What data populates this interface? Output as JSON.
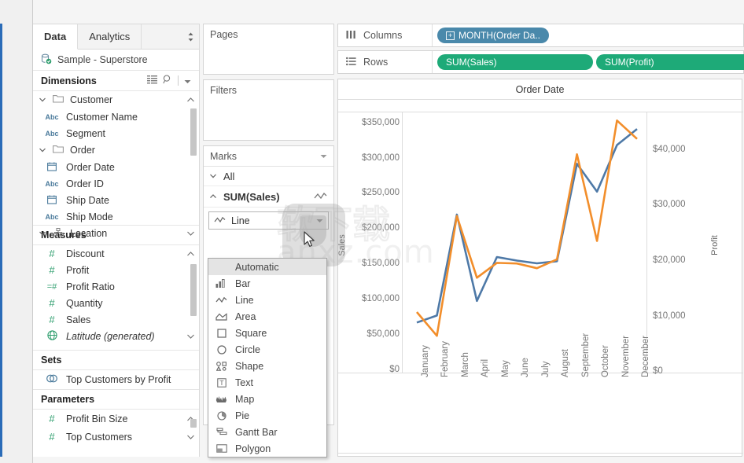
{
  "app": {
    "title": "Tableau Desktop Worksheet"
  },
  "sidebar": {
    "tabs": [
      {
        "label": "Data",
        "active": true
      },
      {
        "label": "Analytics",
        "active": false
      }
    ],
    "tab_caret_icon": "sort-caret-icon",
    "datasource": {
      "name": "Sample - Superstore",
      "icon": "database-connected-icon"
    },
    "dimensions": {
      "header": "Dimensions",
      "icons": [
        "grid-view-icon",
        "search-icon",
        "dropdown-caret-icon"
      ],
      "groups": [
        {
          "name": "Customer",
          "fields": [
            {
              "label": "Customer Name",
              "type": "Abc"
            },
            {
              "label": "Segment",
              "type": "Abc"
            }
          ]
        },
        {
          "name": "Order",
          "fields": [
            {
              "label": "Order Date",
              "type": "date"
            },
            {
              "label": "Order ID",
              "type": "Abc"
            },
            {
              "label": "Ship Date",
              "type": "date"
            },
            {
              "label": "Ship Mode",
              "type": "Abc"
            }
          ]
        },
        {
          "name": "Location",
          "fields": []
        }
      ]
    },
    "measures": {
      "header": "Measures",
      "fields": [
        {
          "label": "Discount",
          "type": "number",
          "italic": false
        },
        {
          "label": "Profit",
          "type": "number",
          "italic": false
        },
        {
          "label": "Profit Ratio",
          "type": "calc-number",
          "italic": false
        },
        {
          "label": "Quantity",
          "type": "number",
          "italic": false
        },
        {
          "label": "Sales",
          "type": "number",
          "italic": false
        },
        {
          "label": "Latitude (generated)",
          "type": "geo",
          "italic": true
        }
      ]
    },
    "sets": {
      "header": "Sets",
      "items": [
        {
          "label": "Top Customers by Profit",
          "icon": "set-icon"
        }
      ]
    },
    "parameters": {
      "header": "Parameters",
      "items": [
        {
          "label": "Profit Bin Size",
          "type": "number"
        },
        {
          "label": "Top Customers",
          "type": "number"
        }
      ]
    }
  },
  "cards": {
    "pages": {
      "title": "Pages"
    },
    "filters": {
      "title": "Filters"
    },
    "marks": {
      "title": "Marks",
      "all_row": "All",
      "measure_row": "SUM(Sales)",
      "selected_mark_type": "Line",
      "mark_type_icon": "line-chart-icon",
      "dropdown_open": true,
      "options": [
        {
          "label": "Automatic",
          "icon": "none",
          "highlighted": true
        },
        {
          "label": "Bar",
          "icon": "bar-icon",
          "highlighted": false
        },
        {
          "label": "Line",
          "icon": "line-icon",
          "highlighted": false
        },
        {
          "label": "Area",
          "icon": "area-icon",
          "highlighted": false
        },
        {
          "label": "Square",
          "icon": "square-icon",
          "highlighted": false
        },
        {
          "label": "Circle",
          "icon": "circle-icon",
          "highlighted": false
        },
        {
          "label": "Shape",
          "icon": "shape-icon",
          "highlighted": false
        },
        {
          "label": "Text",
          "icon": "text-icon",
          "highlighted": false
        },
        {
          "label": "Map",
          "icon": "map-icon",
          "highlighted": false
        },
        {
          "label": "Pie",
          "icon": "pie-icon",
          "highlighted": false
        },
        {
          "label": "Gantt Bar",
          "icon": "gantt-icon",
          "highlighted": false
        },
        {
          "label": "Polygon",
          "icon": "polygon-icon",
          "highlighted": false
        }
      ]
    }
  },
  "shelves": {
    "columns": {
      "label": "Columns",
      "icon": "columns-icon",
      "pills": [
        {
          "text": "MONTH(Order Da..",
          "color": "blue",
          "has_plus": true
        }
      ]
    },
    "rows": {
      "label": "Rows",
      "icon": "rows-icon",
      "pills": [
        {
          "text": "SUM(Sales)",
          "color": "green",
          "has_plus": false
        },
        {
          "text": "SUM(Profit)",
          "color": "green",
          "has_plus": false
        }
      ]
    }
  },
  "colors": {
    "pill_blue": "#4a89ab",
    "pill_green": "#1eaa78",
    "sales_line": "#4e79a7",
    "profit_line": "#f28e2b",
    "accent_rail": "#2b6cb8"
  },
  "watermark": {
    "text_cn": "软件下载",
    "text_en": "anxz.com"
  },
  "chart_data": {
    "type": "line",
    "title": "Order Date",
    "xlabel": "",
    "ylabel": "Sales",
    "y2label": "Profit",
    "categories": [
      "January",
      "February",
      "March",
      "April",
      "May",
      "June",
      "July",
      "August",
      "September",
      "October",
      "November",
      "December"
    ],
    "yticks_left": [
      "$0",
      "$50,000",
      "$100,000",
      "$150,000",
      "$200,000",
      "$250,000",
      "$300,000",
      "$350,000"
    ],
    "yticks_right": [
      "$0",
      "$10,000",
      "$20,000",
      "$30,000",
      "$40,000"
    ],
    "ylim_left": [
      0,
      375000
    ],
    "ylim_right": [
      0,
      44000
    ],
    "grid": false,
    "legend_position": "none",
    "series": [
      {
        "name": "SUM(Sales)",
        "axis": "left",
        "color": "#4e79a7",
        "values": [
          72000,
          82000,
          227000,
          103000,
          166000,
          161000,
          157000,
          160000,
          300000,
          260000,
          327000,
          350000
        ]
      },
      {
        "name": "SUM(Profit)",
        "axis": "right",
        "color": "#f28e2b",
        "values": [
          10200,
          6200,
          26400,
          16000,
          18500,
          18400,
          17600,
          19100,
          36800,
          22200,
          42500,
          39400
        ]
      }
    ]
  }
}
